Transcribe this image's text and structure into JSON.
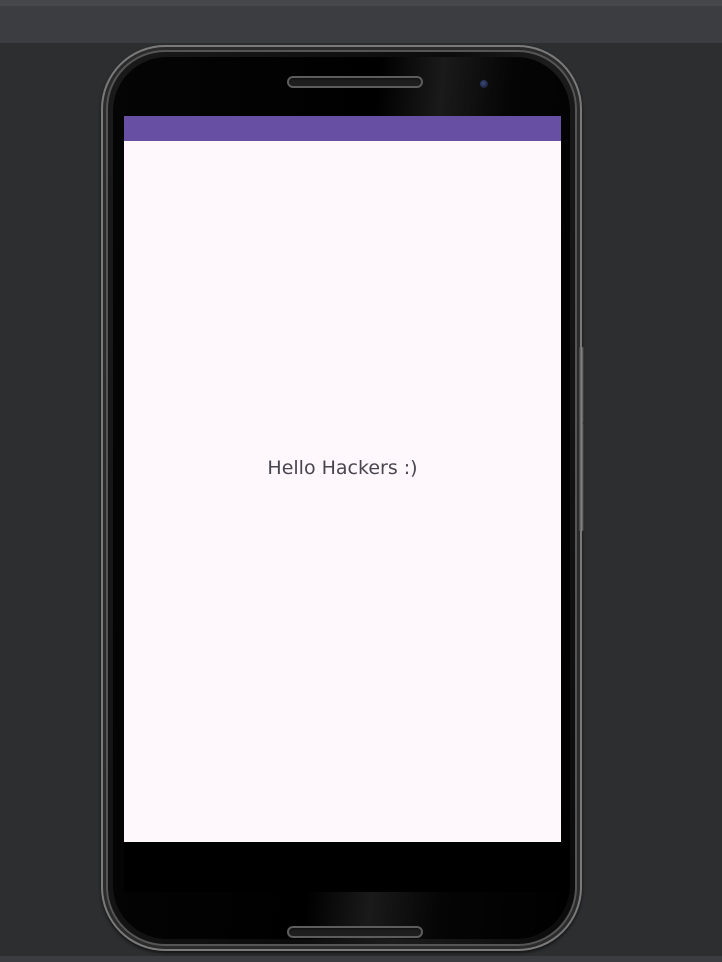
{
  "app": {
    "main_text": "Hello Hackers :)"
  },
  "colors": {
    "status_bar": "#6750a4",
    "screen_background": "#fef8fd",
    "text": "#49454f",
    "ide_background": "#2d2e30"
  }
}
